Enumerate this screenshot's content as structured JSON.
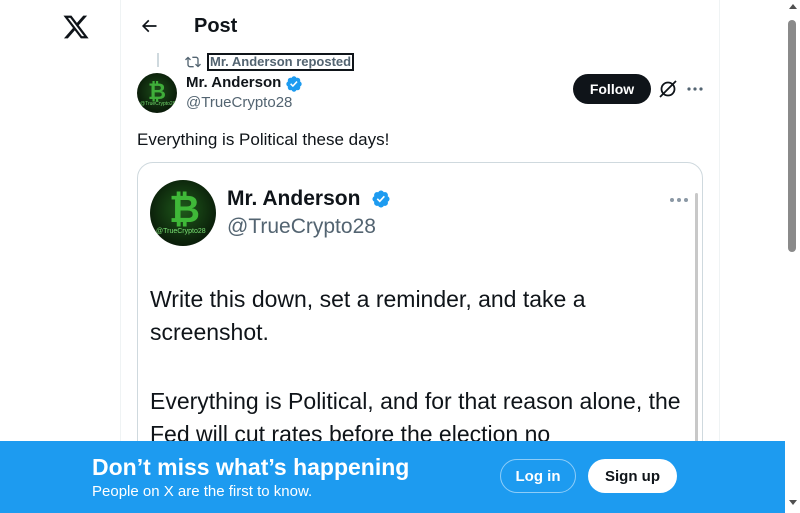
{
  "header": {
    "title": "Post"
  },
  "repost": {
    "label": "Mr. Anderson reposted"
  },
  "author": {
    "name": "Mr. Anderson",
    "handle": "@TrueCrypto28",
    "avatar_tag": "@TrueCrypto28"
  },
  "actions": {
    "follow_label": "Follow",
    "grok_icon": "grok-icon",
    "more_icon": "more-icon"
  },
  "post": {
    "text": "Everything is Political these days!"
  },
  "media": {
    "name": "Mr. Anderson",
    "handle": "@TrueCrypto28",
    "avatar_tag": "@TrueCrypto28",
    "paragraph1": "Write this down, set a reminder, and take a screenshot.",
    "paragraph2": "Everything is Political, and for that reason alone, the Fed will cut rates before the election no"
  },
  "banner": {
    "title": "Don’t miss what’s happening",
    "subtitle": "People on X are the first to know.",
    "login_label": "Log in",
    "signup_label": "Sign up"
  },
  "colors": {
    "accent": "#1d9bf0",
    "text": "#0f1419",
    "muted": "#536471",
    "verified": "#1d9bf0"
  }
}
